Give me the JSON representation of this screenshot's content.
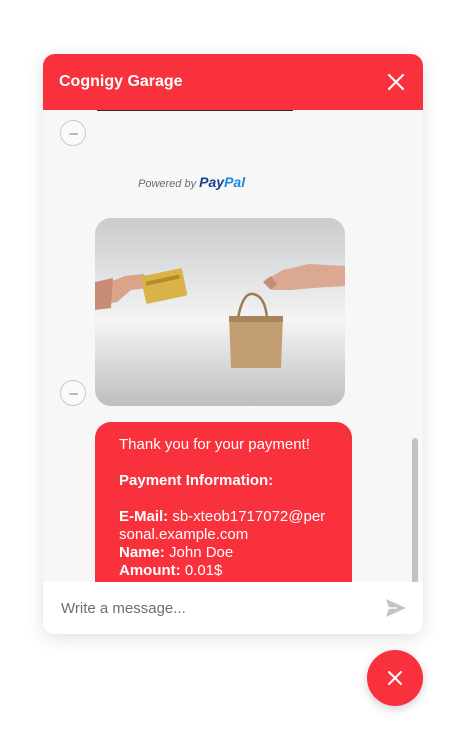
{
  "header": {
    "title": "Cognigy Garage"
  },
  "paypal": {
    "powered_by": "Powered by",
    "brand_pay": "Pay",
    "brand_pal": "Pal"
  },
  "message": {
    "thanks": "Thank you for your payment!",
    "info_heading": "Payment Information:",
    "email_label": "E-Mail:",
    "email_value": "sb-xteob1717072@personal.example.com",
    "name_label": "Name:",
    "name_value": "John Doe",
    "amount_label": "Amount:",
    "amount_value": "0.01$"
  },
  "input": {
    "placeholder": "Write a message..."
  },
  "colors": {
    "accent": "#f8313d"
  },
  "icons": [
    "close-icon",
    "bot-avatar-icon",
    "send-icon",
    "close-chat-icon"
  ]
}
